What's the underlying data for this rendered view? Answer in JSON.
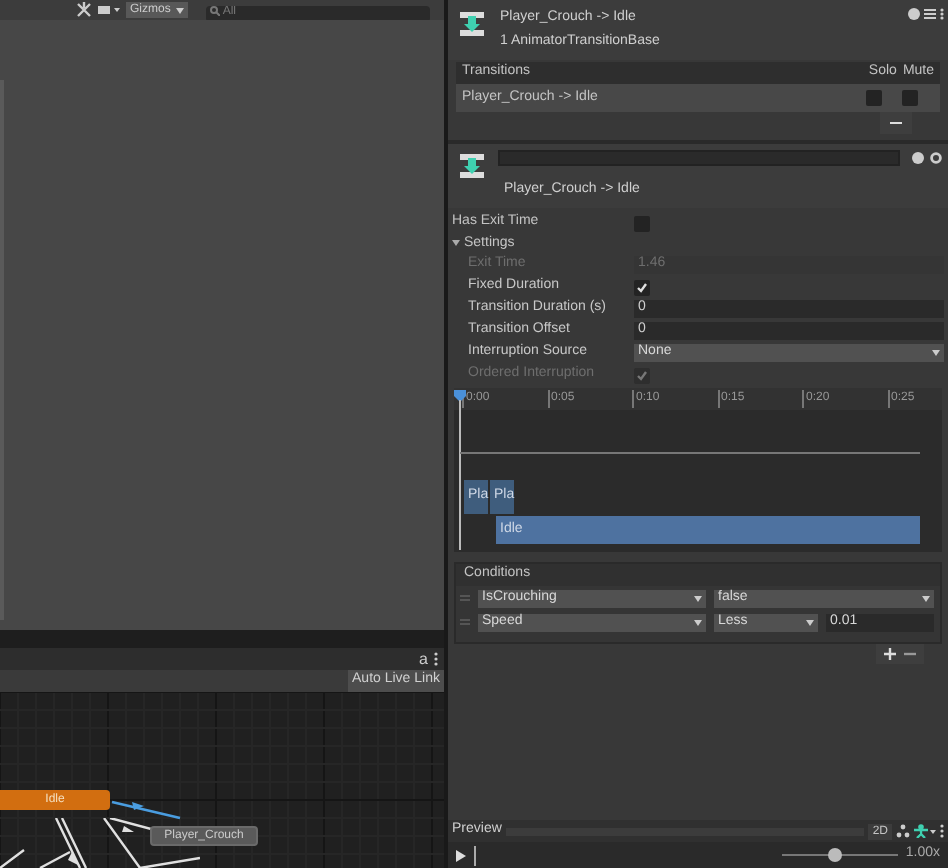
{
  "scene_toolbar": {
    "gizmos_label": "Gizmos",
    "search": {
      "placeholder": "All"
    }
  },
  "animator_toolbar": {
    "lock_glyph": "a",
    "auto_live_link": {
      "label": "Auto Live Link",
      "on": false
    }
  },
  "graph": {
    "nodes": [
      {
        "label": "Idle",
        "kind": "default"
      },
      {
        "label": "Player_Crouch",
        "kind": "normal"
      }
    ]
  },
  "inspector": {
    "title": "Player_Crouch -> Idle",
    "subtitle": "1 AnimatorTransitionBase",
    "transitions": {
      "header": "Transitions",
      "solo_label": "Solo",
      "mute_label": "Mute",
      "rows": [
        {
          "name": "Player_Crouch -> Idle",
          "selected": true,
          "solo": false,
          "mute": false
        }
      ]
    },
    "transition_name": "Player_Crouch -> Idle",
    "has_exit_time": {
      "label": "Has Exit Time",
      "checked": false
    },
    "settings": {
      "label": "Settings",
      "expanded": true,
      "fields": [
        {
          "label": "Exit Time",
          "kind": "number",
          "value": "1.46",
          "disabled": true
        },
        {
          "label": "Fixed Duration",
          "kind": "checkbox",
          "checked": true,
          "disabled": false
        },
        {
          "label": "Transition Duration (s)",
          "kind": "number",
          "value": "0",
          "disabled": false
        },
        {
          "label": "Transition Offset",
          "kind": "number",
          "value": "0",
          "disabled": false
        },
        {
          "label": "Interruption Source",
          "kind": "dropdown",
          "value": "None",
          "disabled": false
        },
        {
          "label": "Ordered Interruption",
          "kind": "checkbox",
          "checked": true,
          "disabled": true
        }
      ]
    },
    "timeline": {
      "ticks": [
        "0:00",
        "0:05",
        "0:10",
        "0:15",
        "0:20",
        "0:25"
      ],
      "clips": [
        "Pla",
        "Pla",
        "Idle"
      ]
    },
    "conditions": {
      "label": "Conditions",
      "rows": [
        {
          "parameter": "IsCrouching",
          "mode": "false",
          "kind": "bool"
        },
        {
          "parameter": "Speed",
          "mode": "Less",
          "value": "0.01",
          "kind": "float"
        }
      ]
    },
    "preview": {
      "label": "Preview",
      "mode_2d": "2D",
      "speed": "1.00x",
      "level": 0.45
    }
  }
}
